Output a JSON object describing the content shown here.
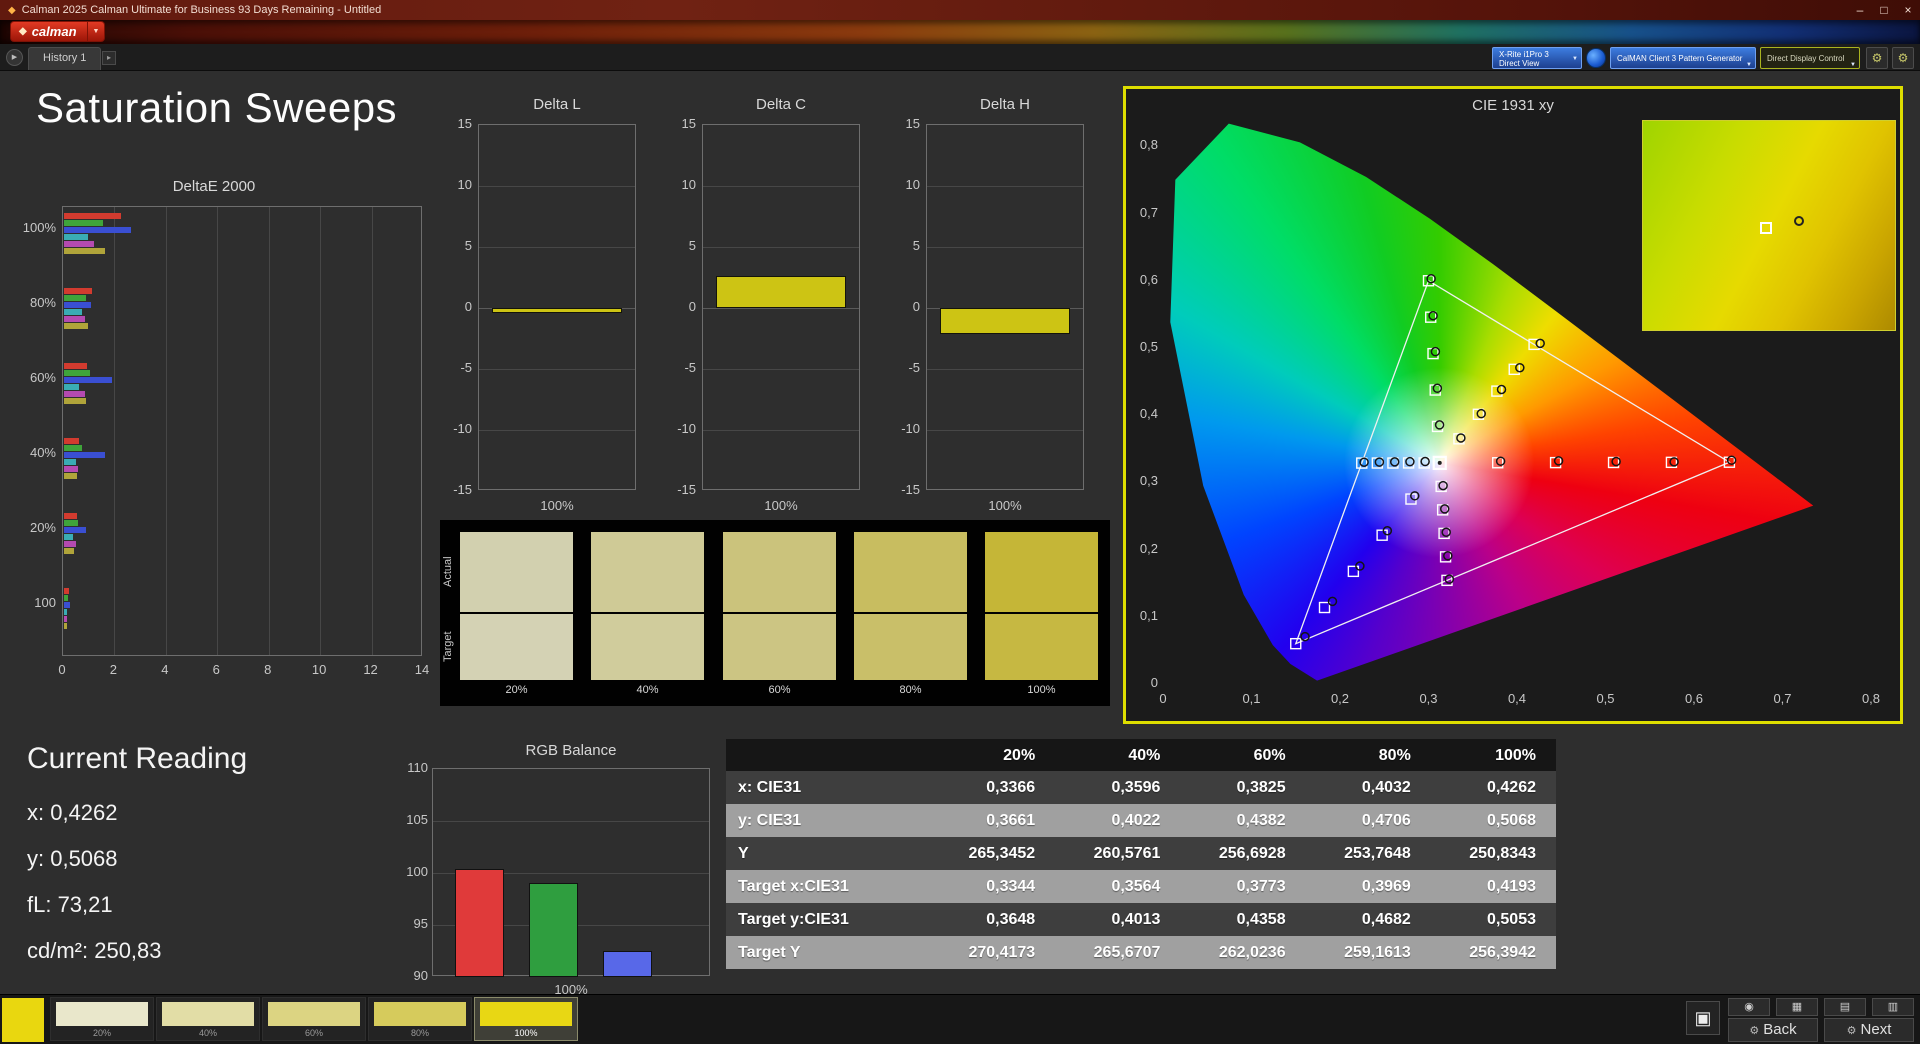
{
  "titlebar": {
    "title": "Calman 2025 Calman Ultimate for Business 93 Days Remaining - Untitled",
    "minimize": "–",
    "maximize": "□",
    "close": "×"
  },
  "ribbon": {
    "logo_text": "calman",
    "logo_mark": "◆",
    "caret": "▼"
  },
  "tabstrip": {
    "history_tab": "History 1",
    "nav_arrow": "▶",
    "tab_next_arrow": "▸"
  },
  "devices": {
    "meter_line1": "X-Rite i1Pro 3",
    "meter_line2": "Direct View",
    "source_label": "CalMAN Client 3 Pattern Generator",
    "display_label": "Direct Display Control",
    "caret": "▼",
    "gear": "⚙"
  },
  "page_title": "Saturation Sweeps",
  "current_reading": {
    "title": "Current Reading",
    "values": [
      "x: 0,4262",
      "y: 0,5068",
      "fL: 73,21",
      "cd/m²: 250,83"
    ]
  },
  "compare": {
    "row_labels": [
      "Actual",
      "Target"
    ],
    "columns": [
      {
        "label": "20%",
        "actual": "#d2d0af",
        "target": "#d4d2b4"
      },
      {
        "label": "40%",
        "actual": "#cfca96",
        "target": "#d0cc9c"
      },
      {
        "label": "60%",
        "actual": "#cbc37c",
        "target": "#ccc583"
      },
      {
        "label": "80%",
        "actual": "#c8bd60",
        "target": "#c9bf69"
      },
      {
        "label": "100%",
        "actual": "#c5b637",
        "target": "#c6b842"
      }
    ]
  },
  "table": {
    "columns": [
      "",
      "20%",
      "40%",
      "60%",
      "80%",
      "100%"
    ],
    "rows": [
      {
        "label": "x: CIE31",
        "values": [
          "0,3366",
          "0,3596",
          "0,3825",
          "0,4032",
          "0,4262"
        ]
      },
      {
        "label": "y: CIE31",
        "values": [
          "0,3661",
          "0,4022",
          "0,4382",
          "0,4706",
          "0,5068"
        ]
      },
      {
        "label": "Y",
        "values": [
          "265,3452",
          "260,5761",
          "256,6928",
          "253,7648",
          "250,8343"
        ]
      },
      {
        "label": "Target x:CIE31",
        "values": [
          "0,3344",
          "0,3564",
          "0,3773",
          "0,3969",
          "0,4193"
        ]
      },
      {
        "label": "Target y:CIE31",
        "values": [
          "0,3648",
          "0,4013",
          "0,4358",
          "0,4682",
          "0,5053"
        ]
      },
      {
        "label": "Target Y",
        "values": [
          "270,4173",
          "265,6707",
          "262,0236",
          "259,1613",
          "256,3942"
        ]
      }
    ]
  },
  "footer": {
    "current_color": "#e9d70f",
    "levels": [
      {
        "label": "20%",
        "color": "#e9e7cb",
        "selected": false
      },
      {
        "label": "40%",
        "color": "#e2dda6",
        "selected": false
      },
      {
        "label": "60%",
        "color": "#dcd482",
        "selected": false
      },
      {
        "label": "80%",
        "color": "#d6cb5c",
        "selected": false
      },
      {
        "label": "100%",
        "color": "#e8d714",
        "selected": true
      }
    ],
    "back": "Back",
    "next": "Next",
    "gear": "⚙",
    "mini_icons": [
      "◉",
      "▦",
      "▤",
      "▥"
    ],
    "display_icon": "▣"
  },
  "chart_data": [
    {
      "id": "deltae2000",
      "type": "bar",
      "orientation": "horizontal",
      "title": "DeltaE 2000",
      "categories": [
        "100%",
        "80%",
        "60%",
        "40%",
        "20%",
        "100"
      ],
      "series": [
        {
          "name": "red",
          "color": "#d23b2f",
          "values": [
            2.2,
            1.1,
            0.9,
            0.6,
            0.5,
            0.2
          ]
        },
        {
          "name": "green",
          "color": "#3fa43a",
          "values": [
            1.5,
            0.85,
            1.0,
            0.7,
            0.55,
            0.15
          ]
        },
        {
          "name": "blue",
          "color": "#3a4fd2",
          "values": [
            2.6,
            1.05,
            1.85,
            1.6,
            0.85,
            0.25
          ]
        },
        {
          "name": "cyan",
          "color": "#3aacb4",
          "values": [
            0.95,
            0.7,
            0.6,
            0.45,
            0.35,
            0.1
          ]
        },
        {
          "name": "magenta",
          "color": "#b44ab0",
          "values": [
            1.15,
            0.8,
            0.8,
            0.55,
            0.45,
            0.12
          ]
        },
        {
          "name": "yellow",
          "color": "#b0a43a",
          "values": [
            1.6,
            0.95,
            0.85,
            0.5,
            0.4,
            0.1
          ]
        }
      ],
      "xlim": [
        0,
        14
      ],
      "xticks": [
        0,
        2,
        4,
        6,
        8,
        10,
        12,
        14
      ]
    },
    {
      "id": "delta_l",
      "type": "bar",
      "title": "Delta L",
      "value": -0.4,
      "ylim": [
        -15,
        15
      ],
      "yticks": [
        15,
        10,
        5,
        0,
        -5,
        -10,
        -15
      ],
      "xlabel": "100%",
      "bar_color": "#cdc414"
    },
    {
      "id": "delta_c",
      "type": "bar",
      "title": "Delta C",
      "value": 2.6,
      "ylim": [
        -15,
        15
      ],
      "yticks": [
        15,
        10,
        5,
        0,
        -5,
        -10,
        -15
      ],
      "xlabel": "100%",
      "bar_color": "#cdc414"
    },
    {
      "id": "delta_h",
      "type": "bar",
      "title": "Delta H",
      "value": -2.1,
      "ylim": [
        -15,
        15
      ],
      "yticks": [
        15,
        10,
        5,
        0,
        -5,
        -10,
        -15
      ],
      "xlabel": "100%",
      "bar_color": "#cdc414"
    },
    {
      "id": "rgb_balance",
      "type": "bar",
      "title": "RGB Balance",
      "categories": [
        "Red",
        "Green",
        "Blue"
      ],
      "values": [
        100.4,
        99.0,
        92.5
      ],
      "colors": [
        "#e03a3a",
        "#2f9e3f",
        "#5868e8"
      ],
      "ylim": [
        90,
        110
      ],
      "yticks": [
        110,
        105,
        100,
        95,
        90
      ],
      "xlabel": "100%"
    },
    {
      "id": "cie",
      "type": "scatter",
      "title": "CIE 1931 xy",
      "xlim": [
        0,
        0.8
      ],
      "ylim": [
        0,
        0.8
      ],
      "xticks": [
        "0",
        "0,1",
        "0,2",
        "0,3",
        "0,4",
        "0,5",
        "0,6",
        "0,7",
        "0,8"
      ],
      "yticks": [
        "0",
        "0,1",
        "0,2",
        "0,3",
        "0,4",
        "0,5",
        "0,6",
        "0,7",
        "0,8"
      ],
      "white_point": [
        0.3127,
        0.329
      ],
      "gamut": {
        "red": [
          0.64,
          0.33
        ],
        "green": [
          0.3,
          0.6
        ],
        "blue": [
          0.15,
          0.06
        ]
      },
      "sweeps": [
        {
          "name": "red",
          "targets": [
            [
              0.3782,
              0.3292
            ],
            [
              0.4436,
              0.3294
            ],
            [
              0.5091,
              0.3296
            ],
            [
              0.5745,
              0.3298
            ],
            [
              0.64,
              0.33
            ]
          ],
          "measured": [
            [
              0.3815,
              0.3315
            ],
            [
              0.447,
              0.332
            ],
            [
              0.512,
              0.331
            ],
            [
              0.5775,
              0.3305
            ],
            [
              0.6425,
              0.333
            ]
          ]
        },
        {
          "name": "yellow",
          "targets": [
            [
              0.3344,
              0.3648
            ],
            [
              0.3564,
              0.4013
            ],
            [
              0.3773,
              0.4358
            ],
            [
              0.3969,
              0.4682
            ],
            [
              0.4193,
              0.5053
            ]
          ],
          "measured": [
            [
              0.3366,
              0.3661
            ],
            [
              0.3596,
              0.4022
            ],
            [
              0.3825,
              0.4382
            ],
            [
              0.4032,
              0.4706
            ],
            [
              0.4262,
              0.5068
            ]
          ]
        },
        {
          "name": "green",
          "targets": [
            [
              0.3102,
              0.3832
            ],
            [
              0.3076,
              0.4374
            ],
            [
              0.3051,
              0.4916
            ],
            [
              0.3025,
              0.5458
            ],
            [
              0.3,
              0.6
            ]
          ],
          "measured": [
            [
              0.3125,
              0.3855
            ],
            [
              0.31,
              0.44
            ],
            [
              0.3078,
              0.4945
            ],
            [
              0.3052,
              0.548
            ],
            [
              0.303,
              0.603
            ]
          ]
        },
        {
          "name": "cyan",
          "targets": [
            [
              0.2951,
              0.3289
            ],
            [
              0.2775,
              0.3289
            ],
            [
              0.2598,
              0.3288
            ],
            [
              0.2422,
              0.3288
            ],
            [
              0.2246,
              0.3287
            ]
          ],
          "measured": [
            [
              0.2962,
              0.331
            ],
            [
              0.279,
              0.3308
            ],
            [
              0.2618,
              0.3305
            ],
            [
              0.2445,
              0.3302
            ],
            [
              0.2272,
              0.33
            ]
          ]
        },
        {
          "name": "blue",
          "targets": [
            [
              0.2802,
              0.2752
            ],
            [
              0.2476,
              0.2214
            ],
            [
              0.2151,
              0.1676
            ],
            [
              0.1825,
              0.1138
            ],
            [
              0.15,
              0.06
            ]
          ],
          "measured": [
            [
              0.2845,
              0.28
            ],
            [
              0.2535,
              0.228
            ],
            [
              0.2225,
              0.1755
            ],
            [
              0.1915,
              0.123
            ],
            [
              0.1605,
              0.0705
            ]
          ]
        },
        {
          "name": "magenta",
          "targets": [
            [
              0.3143,
              0.294
            ],
            [
              0.316,
              0.2591
            ],
            [
              0.3176,
              0.2241
            ],
            [
              0.3193,
              0.1892
            ],
            [
              0.3209,
              0.1542
            ]
          ],
          "measured": [
            [
              0.3165,
              0.2952
            ],
            [
              0.3183,
              0.2605
            ],
            [
              0.32,
              0.2258
            ],
            [
              0.3218,
              0.1908
            ],
            [
              0.3235,
              0.156
            ]
          ]
        }
      ],
      "inset": {
        "square": [
          0.49,
          0.51
        ],
        "circle": [
          0.62,
          0.48
        ]
      }
    }
  ]
}
